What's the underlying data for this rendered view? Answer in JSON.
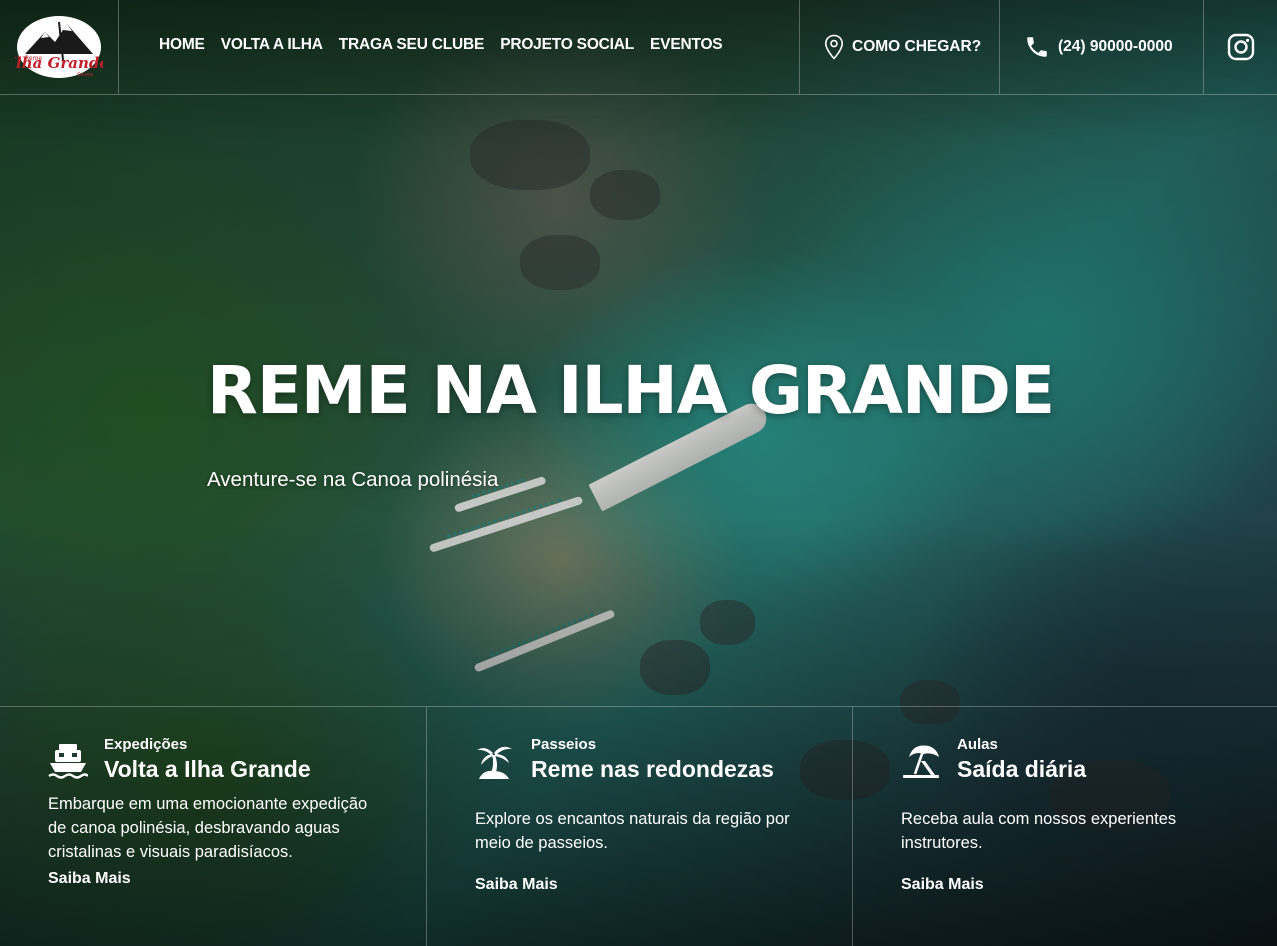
{
  "brand": {
    "logo_alt": "Ilha Grande"
  },
  "nav": {
    "items": [
      {
        "label": "HOME"
      },
      {
        "label": "VOLTA A ILHA"
      },
      {
        "label": "TRAGA SEU CLUBE"
      },
      {
        "label": "PROJETO SOCIAL"
      },
      {
        "label": "EVENTOS"
      }
    ]
  },
  "header": {
    "location_label": "COMO CHEGAR?",
    "location_icon": "map-pin-icon",
    "phone_label": "(24) 90000-0000",
    "phone_icon": "phone-icon",
    "social_icon": "instagram-icon"
  },
  "hero": {
    "title": "REME NA ILHA GRANDE",
    "subtitle": "Aventure-se na Canoa polinésia"
  },
  "cards": [
    {
      "icon": "ship-icon",
      "kicker": "Expedições",
      "title": "Volta a Ilha Grande",
      "description": "Embarque em uma emocionante expedição de canoa polinésia, desbravando aguas cristalinas e visuais paradisíacos.",
      "link": "Saiba Mais"
    },
    {
      "icon": "palm-tree-icon",
      "kicker": "Passeios",
      "title": "Reme nas redondezas",
      "description": "Explore os encantos naturais da região por meio de passeios.",
      "link": "Saiba Mais"
    },
    {
      "icon": "beach-umbrella-icon",
      "kicker": "Aulas",
      "title": "Saída diária",
      "description": "Receba aula com nossos experientes instrutores.",
      "link": "Saiba Mais"
    }
  ],
  "colors": {
    "text": "#ffffff",
    "divider": "rgba(255,255,255,0.28)",
    "water": "#2c8b85",
    "forest": "#2b5a2f"
  }
}
